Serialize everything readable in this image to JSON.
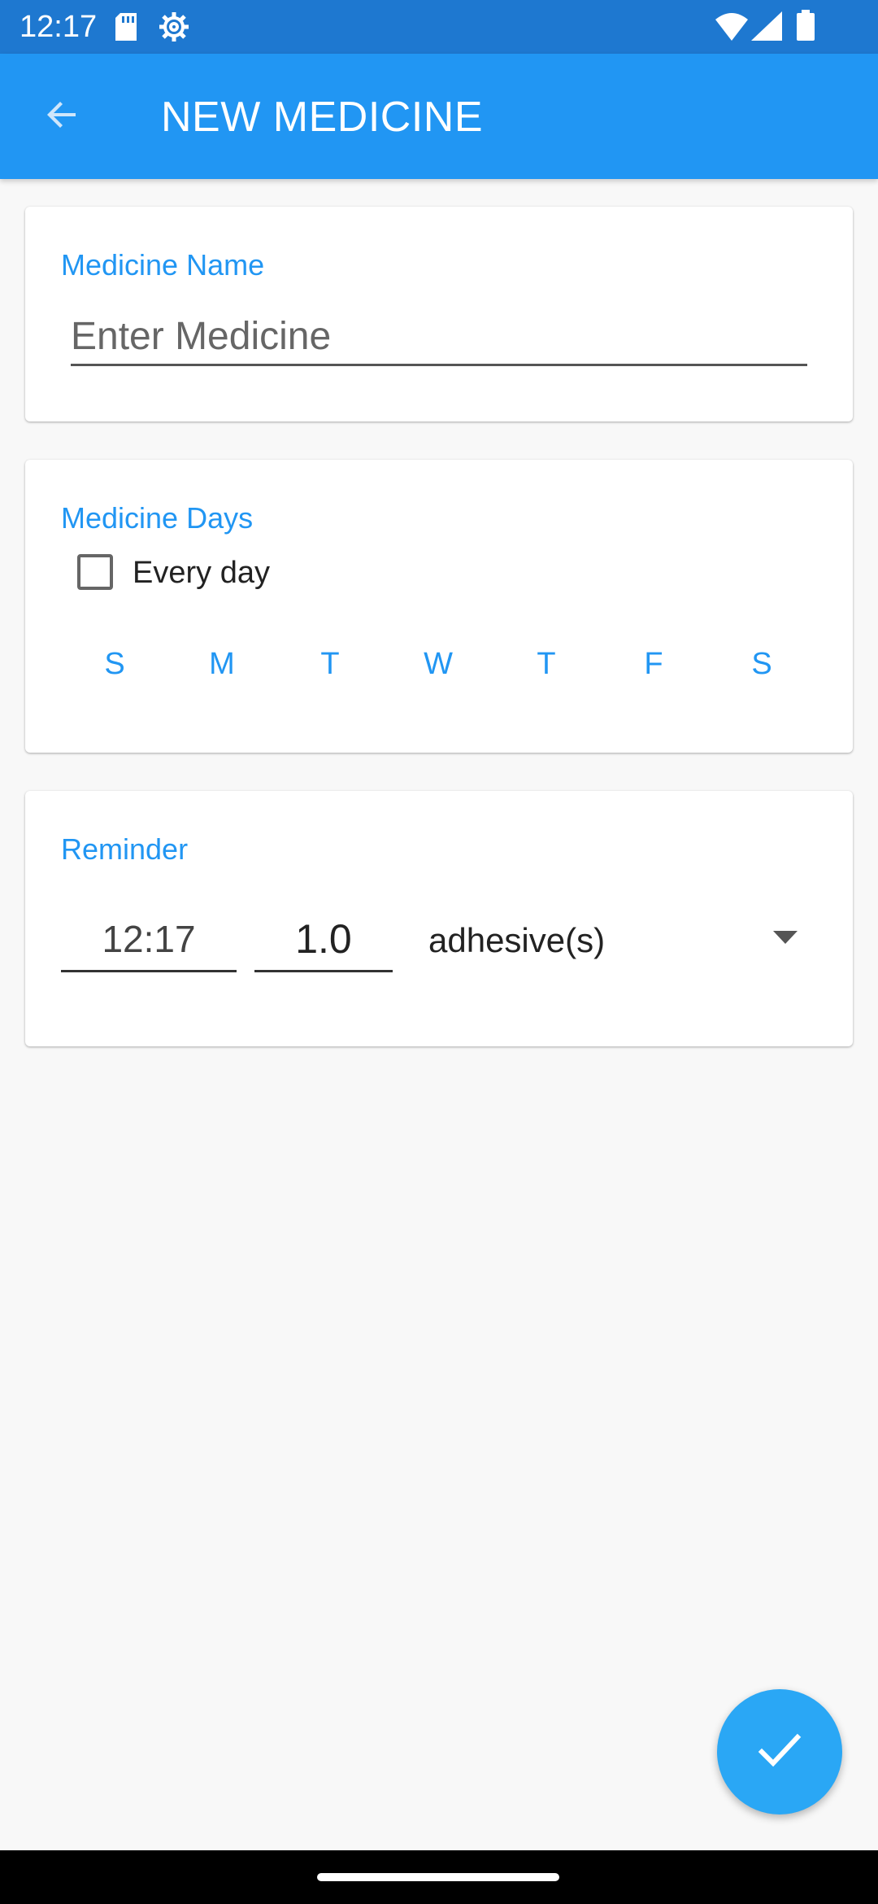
{
  "status_bar": {
    "time": "12:17",
    "icons": [
      "sd-card-icon",
      "gear-icon",
      "wifi-icon",
      "signal-icon",
      "battery-icon"
    ]
  },
  "app_bar": {
    "title": "NEW MEDICINE",
    "back_icon": "arrow-back-icon"
  },
  "medicine_name": {
    "label": "Medicine Name",
    "placeholder": "Enter Medicine",
    "value": ""
  },
  "medicine_days": {
    "label": "Medicine Days",
    "every_day_label": "Every day",
    "every_day_checked": false,
    "days": [
      "S",
      "M",
      "T",
      "W",
      "T",
      "F",
      "S"
    ]
  },
  "reminder": {
    "label": "Reminder",
    "time": "12:17",
    "dose": "1.0",
    "unit": "adhesive(s)"
  },
  "fab": {
    "icon": "check-icon"
  },
  "colors": {
    "status_bar": "#1e78d0",
    "app_bar": "#2196f3",
    "accent": "#2196f3",
    "fab": "#2aa7f5",
    "background": "#f8f8f8"
  }
}
